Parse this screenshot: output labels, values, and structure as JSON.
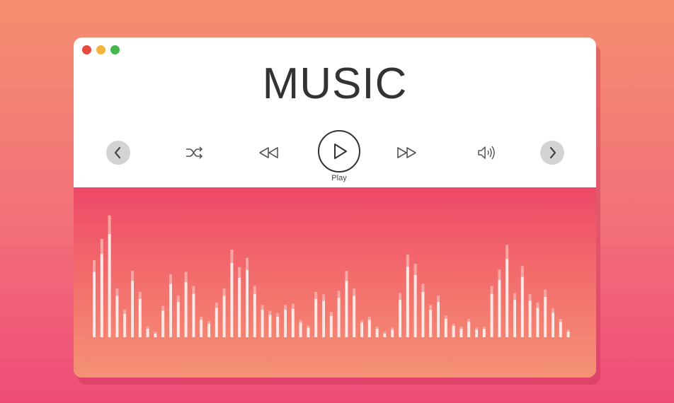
{
  "window": {
    "traffic_lights": [
      "close",
      "minimize",
      "maximize"
    ],
    "title": "MUSIC"
  },
  "controls": {
    "prev_icon": "chevron-left-icon",
    "shuffle_icon": "shuffle-icon",
    "rewind_icon": "rewind-icon",
    "play_icon": "play-icon",
    "play_label": "Play",
    "fast_forward_icon": "fast-forward-icon",
    "volume_icon": "volume-icon",
    "next_icon": "chevron-right-icon"
  },
  "colors": {
    "bar_solid": "#ffe9e7",
    "bar_faded": "#f7a7a3",
    "panel_top": "#ee4868",
    "panel_bottom": "#f59275"
  },
  "equalizer": {
    "levels": [
      0.62,
      0.8,
      1.0,
      0.38,
      0.2,
      0.53,
      0.35,
      0.05,
      0.0,
      0.23,
      0.5,
      0.32,
      0.52,
      0.4,
      0.14,
      0.1,
      0.26,
      0.38,
      0.71,
      0.56,
      0.64,
      0.4,
      0.24,
      0.19,
      0.17,
      0.24,
      0.25,
      0.11,
      0.06,
      0.35,
      0.33,
      0.18,
      0.36,
      0.53,
      0.38,
      0.11,
      0.14,
      0.05,
      0.0,
      0.04,
      0.34,
      0.67,
      0.59,
      0.42,
      0.24,
      0.32,
      0.15,
      0.08,
      0.05,
      0.12,
      0.04,
      0.05,
      0.4,
      0.54,
      0.75,
      0.34,
      0.57,
      0.33,
      0.26,
      0.37,
      0.21,
      0.12,
      0.02
    ]
  }
}
